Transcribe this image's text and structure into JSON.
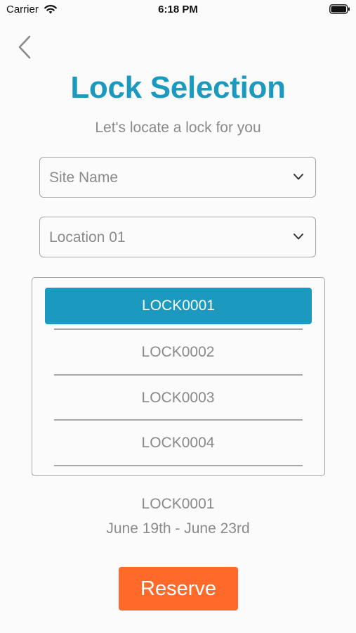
{
  "status_bar": {
    "carrier": "Carrier",
    "time": "6:18 PM"
  },
  "header": {
    "title": "Lock Selection",
    "subtitle": "Let's locate a lock for you"
  },
  "filters": {
    "site_select": "Site Name",
    "location_select": "Location 01"
  },
  "lock_list": {
    "items": [
      "LOCK0001",
      "LOCK0002",
      "LOCK0003",
      "LOCK0004"
    ],
    "selected": "LOCK0001"
  },
  "summary": {
    "lock": "LOCK0001",
    "dates": "June 19th - June 23rd"
  },
  "actions": {
    "reserve_label": "Reserve"
  },
  "colors": {
    "accent": "#1b99bf",
    "reserve": "#ff6a2b"
  }
}
